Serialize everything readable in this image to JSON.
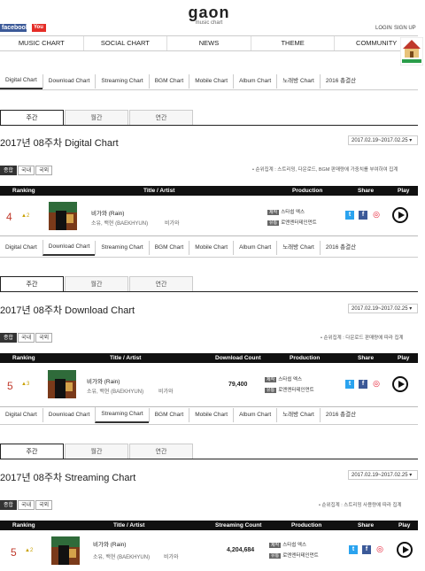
{
  "top": {
    "facebook": "facebook",
    "youtube": "You Tube",
    "logo": "gaon",
    "logo_sub": "music chart",
    "login": "LOGIN",
    "signup": "SIGN UP"
  },
  "gnb": [
    "MUSIC CHART",
    "SOCIAL CHART",
    "NEWS",
    "THEME",
    "COMMUNITY"
  ],
  "chart_tabs": [
    "Digital Chart",
    "Download Chart",
    "Streaming Chart",
    "BGM Chart",
    "Mobile Chart",
    "Album Chart",
    "노래방 Chart",
    "2016 총결산"
  ],
  "periods": [
    "주간",
    "월간",
    "연간"
  ],
  "regions": [
    "종합",
    "국내",
    "국외"
  ],
  "share_label": "Share",
  "play_label": "Play",
  "sections": [
    {
      "title": "2017년 08주차 Digital Chart",
      "date": "2017.02.19~2017.02.25 ▾",
      "note": "• 순위집계 : 스트리밍, 다운로드, BGM 판매량에 가중치를 부여하여 집계",
      "head": {
        "ranking": "Ranking",
        "title_artist": "Title / Artist",
        "production": "Production"
      },
      "entry": {
        "rank": "4",
        "change": "▲2",
        "song": "비가와 (Rain)",
        "artist": "소유, 백현 (BAEKHYUN)",
        "lyric": "비가와",
        "prod1_tag": "제작",
        "prod1": "스타쉽 엑스",
        "prod2_tag": "유통",
        "prod2": "로엔엔터테인먼트"
      }
    },
    {
      "title": "2017년 08주차 Download Chart",
      "date": "2017.02.19~2017.02.25 ▾",
      "note": "• 순위집계 : 다운로드 판매량에 따라 집계",
      "head": {
        "ranking": "Ranking",
        "title_artist": "Title / Artist",
        "count": "Download Count",
        "production": "Production"
      },
      "entry": {
        "rank": "5",
        "change": "▲3",
        "count": "79,400",
        "song": "비가와 (Rain)",
        "artist": "소유, 백현 (BAEKHYUN)",
        "lyric": "비가와",
        "prod1_tag": "제작",
        "prod1": "스타쉽 엑스",
        "prod2_tag": "유통",
        "prod2": "로엔엔터테인먼트"
      }
    },
    {
      "title": "2017년 08주차 Streaming Chart",
      "date": "2017.02.19~2017.02.25 ▾",
      "note": "• 순위집계 : 스트리밍 사용량에 따라 집계",
      "head": {
        "ranking": "Ranking",
        "title_artist": "Title / Artist",
        "count": "Streaming Count",
        "production": "Production"
      },
      "entry": {
        "rank": "5",
        "change": "▲2",
        "count": "4,204,684",
        "song": "비가와 (Rain)",
        "artist": "소유, 백현 (BAEKHYUN)",
        "lyric": "비가와",
        "prod1_tag": "제작",
        "prod1": "스타쉽 엑스",
        "prod2_tag": "유통",
        "prod2": "로엔엔터테인먼트"
      }
    }
  ]
}
